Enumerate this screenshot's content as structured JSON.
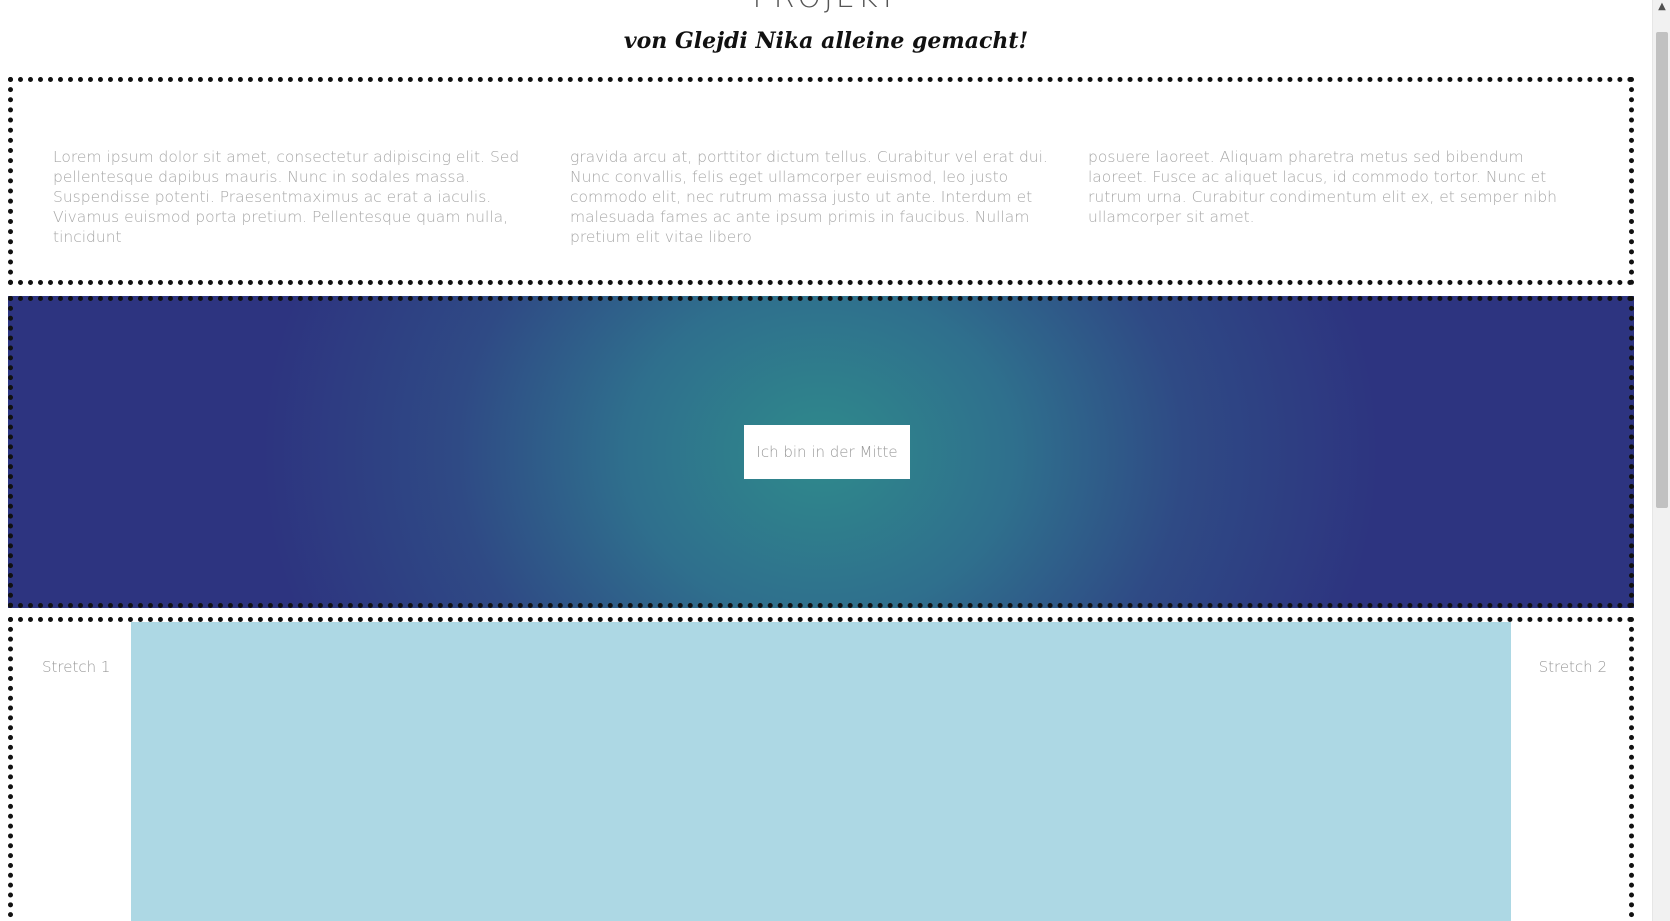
{
  "header": {
    "title": "PROJEKT",
    "subtitle": "von Glejdi Nika alleine gemacht!"
  },
  "text_section": {
    "columns": [
      "Lorem ipsum dolor sit amet, consectetur adipiscing elit. Sed pellentesque dapibus mauris. Nunc in sodales massa. Suspendisse potenti. Praesentmaximus ac erat a iaculis. Vivamus euismod porta pretium. Pellentesque quam nulla, tincidunt",
      "gravida arcu at, porttitor dictum tellus. Curabitur vel erat dui. Nunc convallis, felis eget ullamcorper euismod, leo justo commodo elit, nec rutrum massa justo ut ante. Interdum et malesuada fames ac ante ipsum primis in faucibus. Nullam pretium elit vitae libero",
      "posuere laoreet. Aliquam pharetra metus sed bibendum laoreet. Fusce ac aliquet lacus, id commodo tortor. Nunc et rutrum urna. Curabitur condimentum elit ex, et semper nibh ullamcorper sit amet."
    ]
  },
  "gradient_section": {
    "center_label": "Ich bin in der Mitte",
    "colors": {
      "center": "#2f8a8c",
      "edge": "#2d3480"
    }
  },
  "stretch_section": {
    "label_left": "Stretch 1",
    "label_right": "Stretch 2",
    "fill_color": "#add8e4"
  },
  "scrollbar": {
    "up_arrow": "▲"
  }
}
